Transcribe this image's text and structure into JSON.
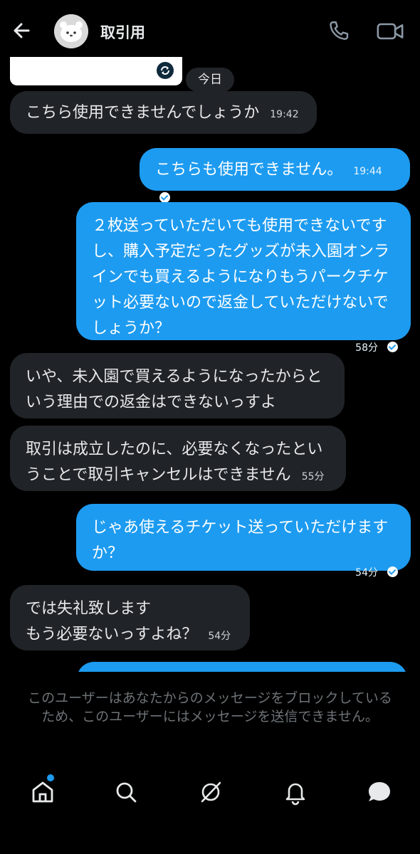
{
  "header": {
    "title": "取引用",
    "icons": [
      "back-arrow-icon",
      "avatar",
      "phone-icon",
      "video-call-icon"
    ]
  },
  "timeline": {
    "date_chip": "今日",
    "messages": [
      {
        "dir": "in",
        "text": "こちら使用できませんでしょうか",
        "time": "19:42"
      },
      {
        "dir": "out",
        "text": "こちらも使用できません。",
        "time": "19:44"
      },
      {
        "dir": "out",
        "text": "２枚送っていただいても使用できないです\nし、購入予定だったグッズが未入園オンラ\nインでも買えるようになりもうパークチケ\nット必要ないので返金していただけないで\nしょうか？",
        "time": "58分"
      },
      {
        "dir": "in",
        "text": "いや、未入園で買えるようになったからと\nいう理由での返金はできないっすよ",
        "time": ""
      },
      {
        "dir": "in",
        "text": "取引は成立したのに、必要なくなったとい\nうことで取引キャンセルはできません",
        "time": "55分"
      },
      {
        "dir": "out",
        "text": "じゃあ使えるチケット送っていただけます\nか？",
        "time": "54分"
      },
      {
        "dir": "in",
        "text": "では失礼致します\nもう必要ないっすよね？",
        "time": "54分"
      }
    ]
  },
  "composer": {
    "blocked_notice": "このユーザーはあなたからのメッセージをブロックしているため、このユーザーにはメッセージを送信できません。"
  },
  "bottom_nav": {
    "items": [
      "home-icon",
      "search-icon",
      "grok-icon",
      "notifications-icon",
      "messages-icon"
    ],
    "accent": "#1d9bf0"
  },
  "colors": {
    "background": "#000000",
    "incoming_bubble": "#202327",
    "outgoing_bubble": "#1d9bf0",
    "muted_text": "#6e7377"
  }
}
